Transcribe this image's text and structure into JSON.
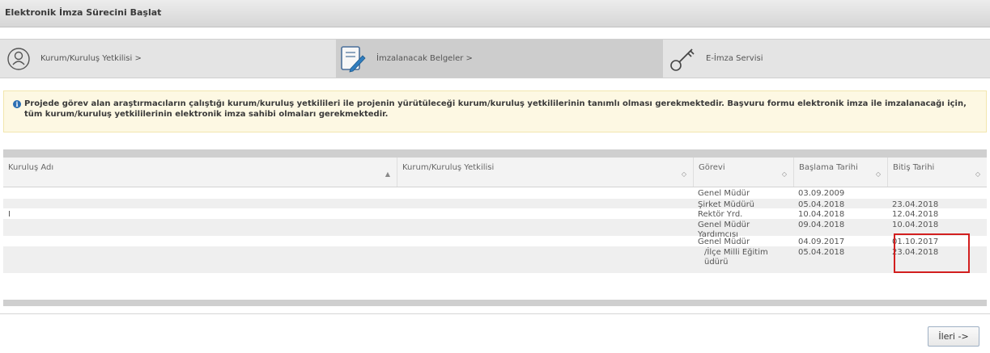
{
  "title": "Elektronik İmza Sürecini Başlat",
  "steps": [
    {
      "label": "Kurum/Kuruluş Yetkilisi >",
      "icon": "user-icon"
    },
    {
      "label": "İmzalanacak Belgeler >",
      "icon": "document-pen-icon"
    },
    {
      "label": "E-İmza Servisi",
      "icon": "key-icon"
    }
  ],
  "info": {
    "icon": "info-icon",
    "text": "Projede görev alan araştırmacıların çalıştığı kurum/kuruluş yetkilileri ile projenin yürütüleceği kurum/kuruluş yetkililerinin tanımlı olması gerekmektedir. Başvuru formu elektronik imza ile imzalanacağı için, tüm kurum/kuruluş yetkililerinin elektronik imza sahibi olmaları gerekmektedir."
  },
  "table": {
    "columns": [
      "Kuruluş Adı",
      "Kurum/Kuruluş Yetkilisi",
      "Görevi",
      "Başlama Tarihi",
      "Bitiş Tarihi"
    ],
    "rows": [
      {
        "kurulus": "",
        "yetkili": "",
        "gorev": "Genel Müdür",
        "baslama": "03.09.2009",
        "bitis": ""
      },
      {
        "kurulus": "",
        "yetkili": "",
        "gorev": "Şirket Müdürü",
        "baslama": "05.04.2018",
        "bitis": "23.04.2018"
      },
      {
        "kurulus": "I",
        "yetkili": "",
        "gorev": "Rektör Yrd.",
        "baslama": "10.04.2018",
        "bitis": "12.04.2018"
      },
      {
        "kurulus": "",
        "yetkili": "",
        "gorev": "Genel Müdür Yardımcısı",
        "baslama": "09.04.2018",
        "bitis": "10.04.2018"
      },
      {
        "kurulus": "",
        "yetkili": "",
        "gorev": "Genel Müdür",
        "baslama": "04.09.2017",
        "bitis": "01.10.2017"
      },
      {
        "kurulus": "",
        "yetkili": "",
        "gorev": "/İlçe Milli Eğitim üdürü",
        "baslama": "05.04.2018",
        "bitis": "23.04.2018"
      }
    ]
  },
  "buttons": {
    "next": "İleri ->"
  },
  "colors": {
    "highlight": "#d21f1f",
    "info_bg": "#fdf8e3",
    "info_icon": "#2c6fb3"
  }
}
